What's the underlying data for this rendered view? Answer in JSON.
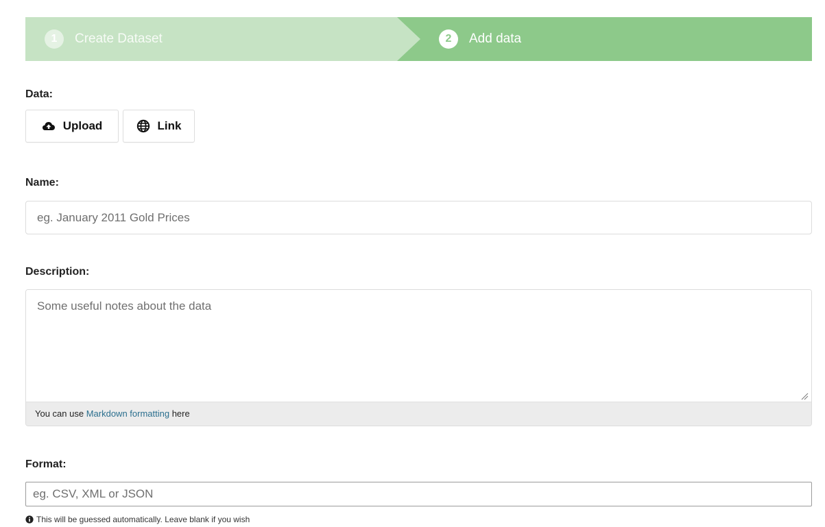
{
  "stepper": {
    "step1": {
      "number": "1",
      "label": "Create Dataset"
    },
    "step2": {
      "number": "2",
      "label": "Add data"
    }
  },
  "data_section": {
    "label": "Data:",
    "upload_label": "Upload",
    "upload_icon": "cloud-upload-icon",
    "link_label": "Link",
    "link_icon": "globe-icon"
  },
  "name_field": {
    "label": "Name:",
    "placeholder": "eg. January 2011 Gold Prices",
    "value": ""
  },
  "description_field": {
    "label": "Description:",
    "placeholder": "Some useful notes about the data",
    "value": "",
    "footer_prefix": "You can use ",
    "footer_link": "Markdown formatting",
    "footer_suffix": " here"
  },
  "format_field": {
    "label": "Format:",
    "placeholder": "eg. CSV, XML or JSON",
    "value": "",
    "help_text": "This will be guessed automatically. Leave blank if you wish",
    "help_icon": "info-circle-icon"
  },
  "colors": {
    "stepper_active": "#8dc98a",
    "stepper_complete": "#c6e3c4",
    "link": "#2b6f8e"
  }
}
